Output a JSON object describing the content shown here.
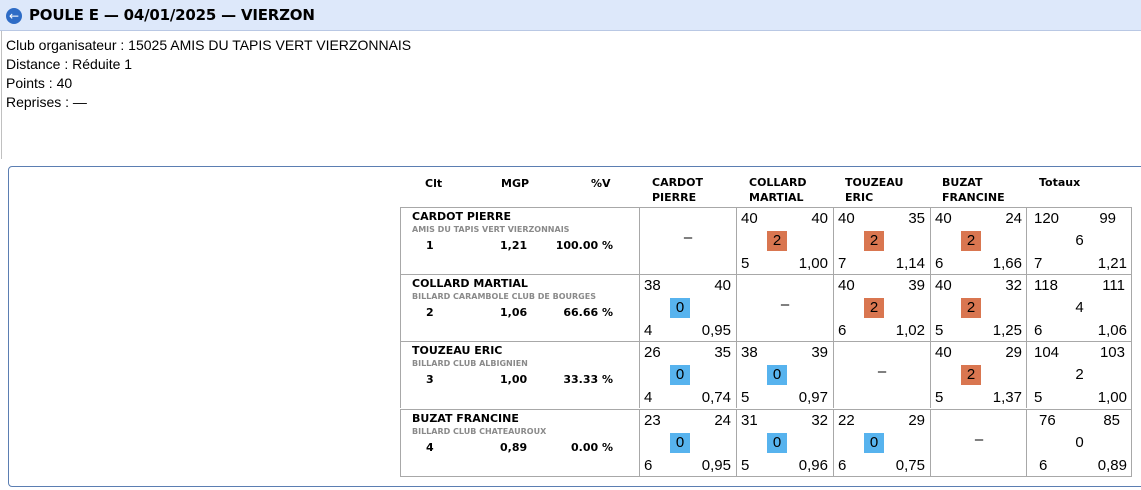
{
  "header": {
    "title": "POULE E — 04/01/2025 — VIERZON",
    "back_icon": "arrow-left-icon"
  },
  "info": {
    "club": "Club organisateur : 15025 AMIS DU TAPIS VERT VIERZONNAIS",
    "distance": "Distance : Réduite 1",
    "points": "Points : 40",
    "reprises": "Reprises : —"
  },
  "table": {
    "headers": {
      "clt": "Clt",
      "mgp": "MGP",
      "pv": "%V",
      "col1_line1": "CARDOT",
      "col1_line2": "PIERRE",
      "col2_line1": "COLLARD",
      "col2_line2": "MARTIAL",
      "col3_line1": "TOUZEAU",
      "col3_line2": "ERIC",
      "col4_line1": "BUZAT",
      "col4_line2": "FRANCINE",
      "totaux": "Totaux"
    },
    "rows": [
      {
        "name": "CARDOT PIERRE",
        "club": "AMIS DU TAPIS VERT VIERZONNAIS",
        "clt": "1",
        "mgp": "1,21",
        "pv": "100.00 %",
        "cells": [
          {
            "dash": "–"
          },
          {
            "pts": "40",
            "opp": "40",
            "res": "2",
            "rep": "5",
            "moy": "1,00"
          },
          {
            "pts": "40",
            "opp": "35",
            "res": "2",
            "rep": "7",
            "moy": "1,14"
          },
          {
            "pts": "40",
            "opp": "24",
            "res": "2",
            "rep": "6",
            "moy": "1,66"
          }
        ],
        "total": {
          "pts": "120",
          "opp": "99",
          "res": "6",
          "rep": "7",
          "moy": "1,21"
        }
      },
      {
        "name": "COLLARD MARTIAL",
        "club": "BILLARD CARAMBOLE CLUB DE BOURGES",
        "clt": "2",
        "mgp": "1,06",
        "pv": "66.66 %",
        "cells": [
          {
            "pts": "38",
            "opp": "40",
            "res": "0",
            "rep": "4",
            "moy": "0,95"
          },
          {
            "dash": "–"
          },
          {
            "pts": "40",
            "opp": "39",
            "res": "2",
            "rep": "6",
            "moy": "1,02"
          },
          {
            "pts": "40",
            "opp": "32",
            "res": "2",
            "rep": "5",
            "moy": "1,25"
          }
        ],
        "total": {
          "pts": "118",
          "opp": "111",
          "res": "4",
          "rep": "6",
          "moy": "1,06"
        }
      },
      {
        "name": "TOUZEAU ERIC",
        "club": "BILLARD CLUB ALBIGNIEN",
        "clt": "3",
        "mgp": "1,00",
        "pv": "33.33 %",
        "cells": [
          {
            "pts": "26",
            "opp": "35",
            "res": "0",
            "rep": "4",
            "moy": "0,74"
          },
          {
            "pts": "38",
            "opp": "39",
            "res": "0",
            "rep": "5",
            "moy": "0,97"
          },
          {
            "dash": "–"
          },
          {
            "pts": "40",
            "opp": "29",
            "res": "2",
            "rep": "5",
            "moy": "1,37"
          }
        ],
        "total": {
          "pts": "104",
          "opp": "103",
          "res": "2",
          "rep": "5",
          "moy": "1,00"
        }
      },
      {
        "name": "BUZAT FRANCINE",
        "club": "BILLARD CLUB CHATEAUROUX",
        "clt": "4",
        "mgp": "0,89",
        "pv": "0.00 %",
        "cells": [
          {
            "pts": "23",
            "opp": "24",
            "res": "0",
            "rep": "6",
            "moy": "0,95"
          },
          {
            "pts": "31",
            "opp": "32",
            "res": "0",
            "rep": "5",
            "moy": "0,96"
          },
          {
            "pts": "22",
            "opp": "29",
            "res": "0",
            "rep": "6",
            "moy": "0,75"
          },
          {
            "dash": "–"
          }
        ],
        "total": {
          "pts": "76",
          "opp": "85",
          "res": "0",
          "rep": "6",
          "moy": "0,89"
        }
      }
    ]
  }
}
